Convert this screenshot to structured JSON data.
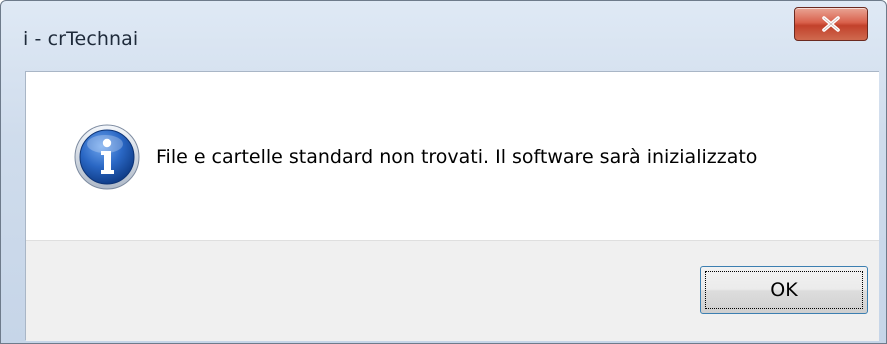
{
  "window": {
    "title": "i - crTechnai",
    "close_icon": "close-icon"
  },
  "dialog": {
    "icon": "info-icon",
    "message": "File e cartelle standard non trovati. Il software sarà inizializzato",
    "ok_label": "OK"
  },
  "colors": {
    "accent": "#3c7fb1",
    "close": "#c2412b",
    "icon_blue": "#1f5fb8"
  }
}
